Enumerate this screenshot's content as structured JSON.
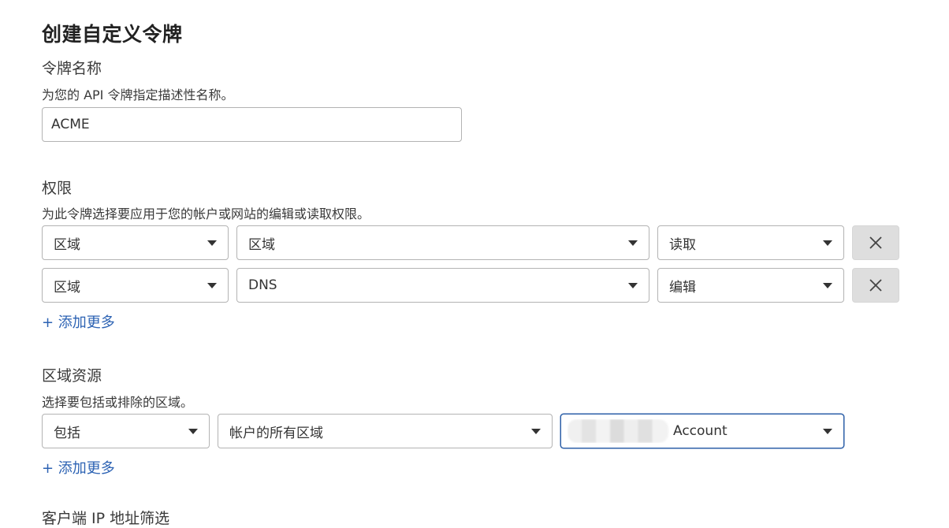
{
  "page": {
    "title": "创建自定义令牌"
  },
  "token_name": {
    "label": "令牌名称",
    "description": "为您的 API 令牌指定描述性名称。",
    "value": "ACME"
  },
  "permissions": {
    "label": "权限",
    "description": "为此令牌选择要应用于您的帐户或网站的编辑或读取权限。",
    "rows": [
      {
        "scope": "区域",
        "resource": "区域",
        "level": "读取"
      },
      {
        "scope": "区域",
        "resource": "DNS",
        "level": "编辑"
      }
    ],
    "add_more": "+ 添加更多"
  },
  "zone_resources": {
    "label": "区域资源",
    "description": "选择要包括或排除的区域。",
    "include": "包括",
    "target": "帐户的所有区域",
    "account": "Account",
    "add_more": "+ 添加更多"
  },
  "next_section": {
    "label_partial": "客户端 IP 地址筛选"
  },
  "colors": {
    "link": "#2c62b3",
    "focus_border": "#2c5fa8",
    "remove_bg": "#dedede"
  },
  "icons": {
    "dropdown": "caret-down-icon",
    "remove": "close-icon"
  }
}
